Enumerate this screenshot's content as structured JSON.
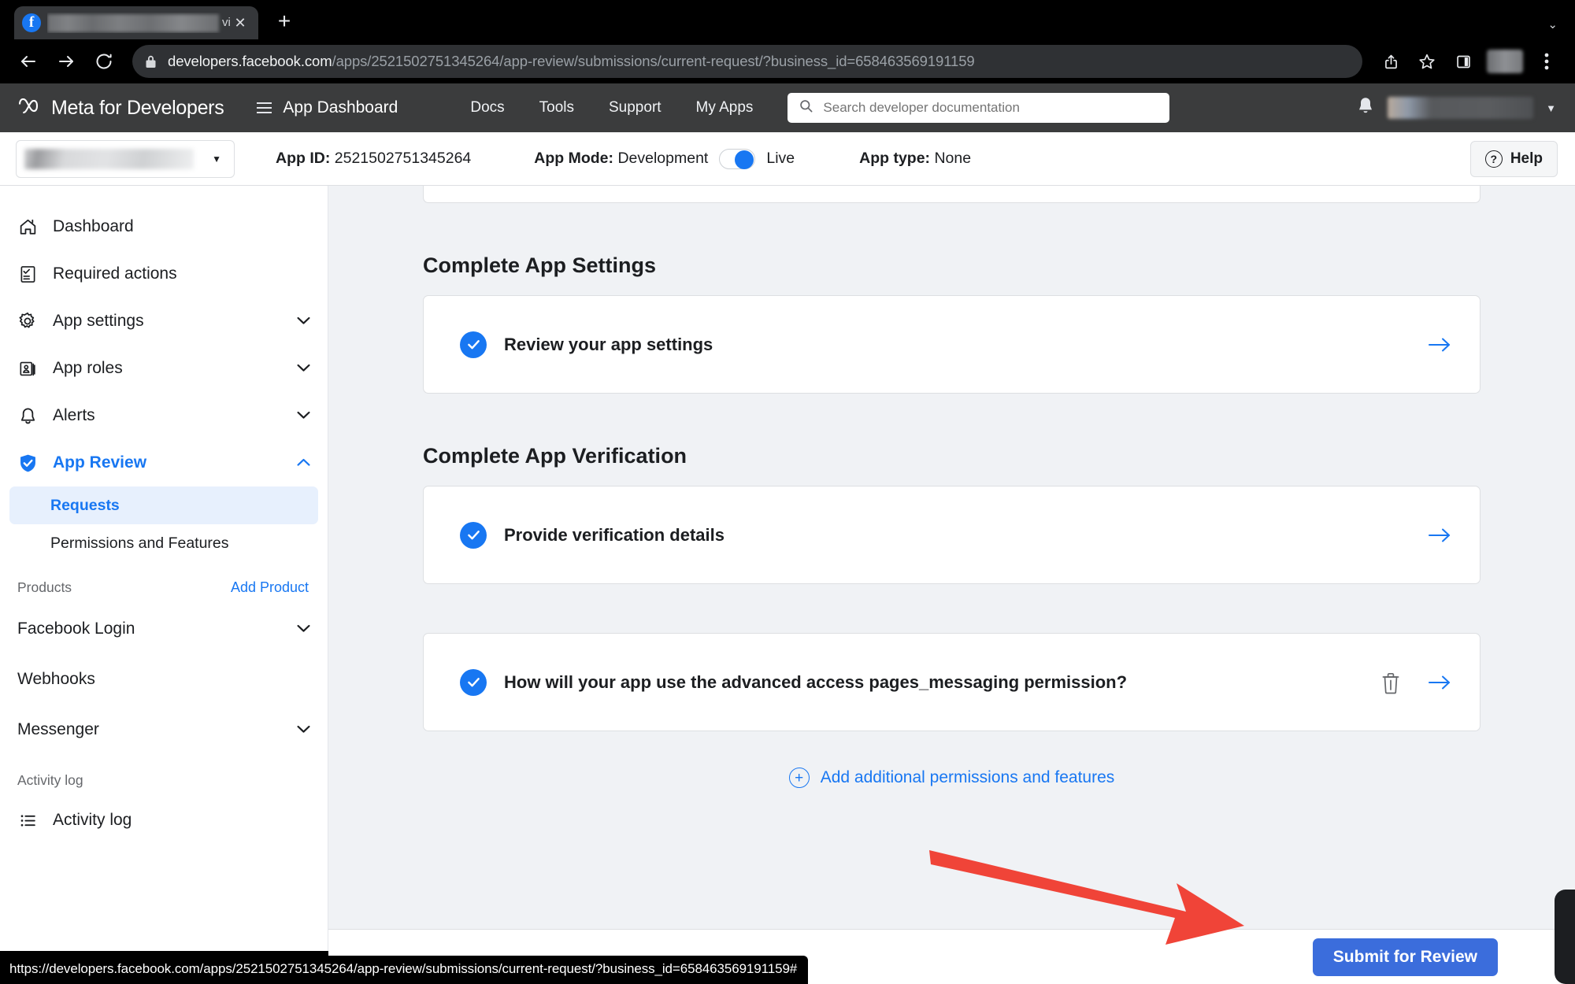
{
  "browser": {
    "tab": {
      "title_visible_tail": "vie",
      "title_redacted": true,
      "favicon": "facebook-favicon",
      "close_label": "✕"
    },
    "newtab_label": "+",
    "window_caret": "⌄",
    "nav": {
      "back_icon": "back-arrow-icon",
      "forward_icon": "forward-arrow-icon",
      "reload_icon": "reload-icon"
    },
    "omnibox": {
      "lock_icon": "lock-icon",
      "host": "developers.facebook.com",
      "path": "/apps/2521502751345264/app-review/submissions/current-request/?business_id=658463569191159",
      "full_url": "developers.facebook.com/apps/2521502751345264/app-review/submissions/current-request/?business_id=658463569191159"
    },
    "toolbar_right": {
      "share_icon": "share-icon",
      "bookmark_icon": "star-icon",
      "sidepanel_icon": "side-panel-icon",
      "profile_icon": "profile-avatar",
      "menu_icon": "three-dot-menu-icon"
    },
    "status_bubble": "https://developers.facebook.com/apps/2521502751345264/app-review/submissions/current-request/?business_id=658463569191159#"
  },
  "header": {
    "brand": "Meta for Developers",
    "brand_logo_icon": "meta-infinity-icon",
    "hamburger_icon": "hamburger-menu-icon",
    "dashboard_title": "App Dashboard",
    "nav_links": [
      {
        "label": "Docs"
      },
      {
        "label": "Tools"
      },
      {
        "label": "Support"
      },
      {
        "label": "My Apps"
      }
    ],
    "search": {
      "placeholder": "Search developer documentation",
      "value": "",
      "icon": "search-icon"
    },
    "notifications_icon": "bell-icon",
    "user_redacted": true,
    "user_caret": "▼",
    "bg_color": "#3b3c3d"
  },
  "app_bar": {
    "app_selector_redacted": true,
    "app_selector_caret": "▼",
    "app_id_label": "App ID:",
    "app_id_value": "2521502751345264",
    "app_mode_label": "App Mode:",
    "app_mode_value": "Development",
    "toggle_right_label": "Live",
    "toggle_on": false,
    "toggle_accent": "#1877f2",
    "app_type_label": "App type:",
    "app_type_value": "None",
    "help_label": "Help",
    "help_icon": "question-circle-icon"
  },
  "sidebar": {
    "items": [
      {
        "label": "Dashboard",
        "icon": "home-icon",
        "chevron": "",
        "active": false
      },
      {
        "label": "Required actions",
        "icon": "checklist-icon",
        "chevron": "",
        "active": false
      },
      {
        "label": "App settings",
        "icon": "gear-icon",
        "chevron": "down",
        "active": false
      },
      {
        "label": "App roles",
        "icon": "id-card-icon",
        "chevron": "down",
        "active": false
      },
      {
        "label": "Alerts",
        "icon": "bell-icon",
        "chevron": "down",
        "active": false
      },
      {
        "label": "App Review",
        "icon": "shield-check-icon",
        "chevron": "up",
        "active": true
      }
    ],
    "subitems": [
      {
        "label": "Requests",
        "selected": true
      },
      {
        "label": "Permissions and Features",
        "selected": false
      }
    ],
    "products_header": "Products",
    "add_product_link": "Add Product",
    "products": [
      {
        "label": "Facebook Login",
        "chevron": "down"
      },
      {
        "label": "Webhooks",
        "chevron": ""
      },
      {
        "label": "Messenger",
        "chevron": "down"
      }
    ],
    "activity_header": "Activity log",
    "activity_items": [
      {
        "label": "Activity log",
        "icon": "list-icon"
      }
    ],
    "accent_color": "#1877f2",
    "selected_bg": "#e7f0fd"
  },
  "main": {
    "sections": [
      {
        "title": "Complete App Settings",
        "cards": [
          {
            "label": "Review your app settings",
            "checked": true,
            "has_trash": false,
            "has_arrow": true
          }
        ]
      },
      {
        "title": "Complete App Verification",
        "cards": [
          {
            "label": "Provide verification details",
            "checked": true,
            "has_trash": false,
            "has_arrow": true
          }
        ]
      },
      {
        "title": "",
        "cards": [
          {
            "label": "How will your app use the advanced access pages_messaging permission?",
            "checked": true,
            "has_trash": true,
            "has_arrow": true
          }
        ]
      }
    ],
    "add_more_label": "Add additional permissions and features",
    "add_more_icon": "plus-circle-icon",
    "arrow_icon": "right-arrow-icon",
    "trash_icon": "trash-icon",
    "check_icon": "check-circle-icon",
    "check_color": "#1877f2",
    "bg_color": "#f0f2f5"
  },
  "footer": {
    "submit_label": "Submit for Review",
    "submit_color": "#3b6ddc"
  },
  "annotation": {
    "arrow_color": "#f04438",
    "points_to": "Submit for Review"
  }
}
